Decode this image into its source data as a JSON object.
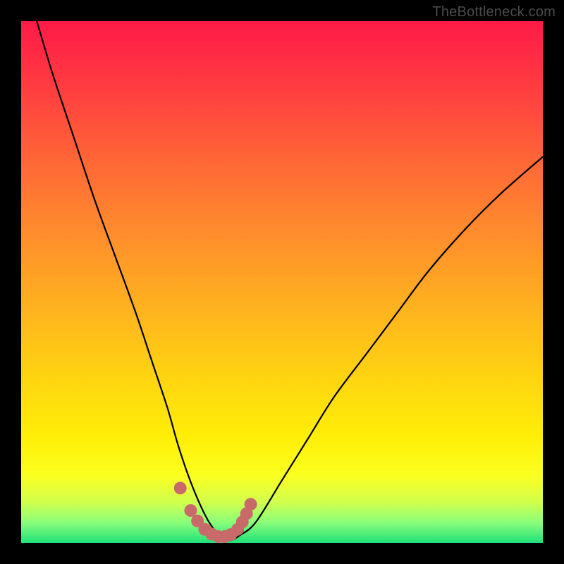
{
  "watermark": "TheBottleneck.com",
  "chart_data": {
    "type": "line",
    "title": "",
    "xlabel": "",
    "ylabel": "",
    "xlim": [
      0,
      100
    ],
    "ylim": [
      0,
      100
    ],
    "grid": false,
    "legend": false,
    "series": [
      {
        "name": "bottleneck-curve",
        "color": "#000000",
        "x": [
          3,
          6,
          10,
          14,
          18,
          22,
          25,
          28,
          30,
          32,
          34,
          36,
          38,
          40,
          42,
          45,
          50,
          55,
          60,
          66,
          72,
          78,
          85,
          92,
          100
        ],
        "y": [
          100,
          90,
          78,
          66,
          55,
          44,
          35,
          26,
          19,
          13,
          8,
          4,
          1.5,
          0.5,
          1.5,
          4,
          12,
          20,
          28,
          36,
          44,
          52,
          60,
          67,
          74
        ]
      }
    ],
    "markers": {
      "name": "highlight-dots",
      "color": "#c96a6a",
      "x": [
        30.5,
        32.5,
        33.8,
        35.2,
        36.5,
        37.8,
        39.0,
        40.2,
        41.5,
        42.4,
        43.2,
        44.0
      ],
      "y": [
        10.5,
        6.2,
        4.2,
        2.6,
        1.7,
        1.2,
        1.2,
        1.6,
        2.6,
        4.0,
        5.6,
        7.4
      ]
    },
    "gradient_stops": [
      {
        "pos": 0.0,
        "color": "#ff1a46"
      },
      {
        "pos": 0.14,
        "color": "#ff4040"
      },
      {
        "pos": 0.4,
        "color": "#ff8b2d"
      },
      {
        "pos": 0.7,
        "color": "#ffd80f"
      },
      {
        "pos": 0.87,
        "color": "#fbff20"
      },
      {
        "pos": 0.96,
        "color": "#8cff7a"
      },
      {
        "pos": 1.0,
        "color": "#22e07a"
      }
    ]
  }
}
